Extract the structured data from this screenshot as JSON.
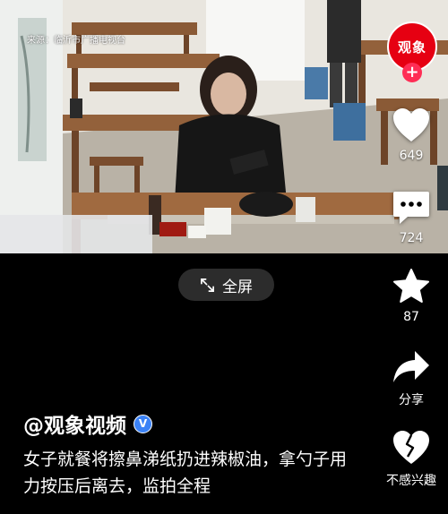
{
  "video": {
    "watermark": "来源：临沂市广播电视台"
  },
  "fullscreen": {
    "label": "全屏"
  },
  "account": {
    "avatar_text": "观象",
    "follow_symbol": "+",
    "name": "@观象视频",
    "verified_mark": "V"
  },
  "actions": {
    "like_count": "649",
    "comment_count": "724",
    "favorite_count": "87",
    "share_label": "分享",
    "dislike_label": "不感兴趣"
  },
  "caption": {
    "text": "女子就餐将擦鼻涕纸扔进辣椒油，拿勺子用力按压后离去，监拍全程"
  },
  "colors": {
    "brand_red": "#e60012",
    "follow_pink": "#ff2d55",
    "verify_blue": "#3b82f6",
    "background": "#000000"
  }
}
